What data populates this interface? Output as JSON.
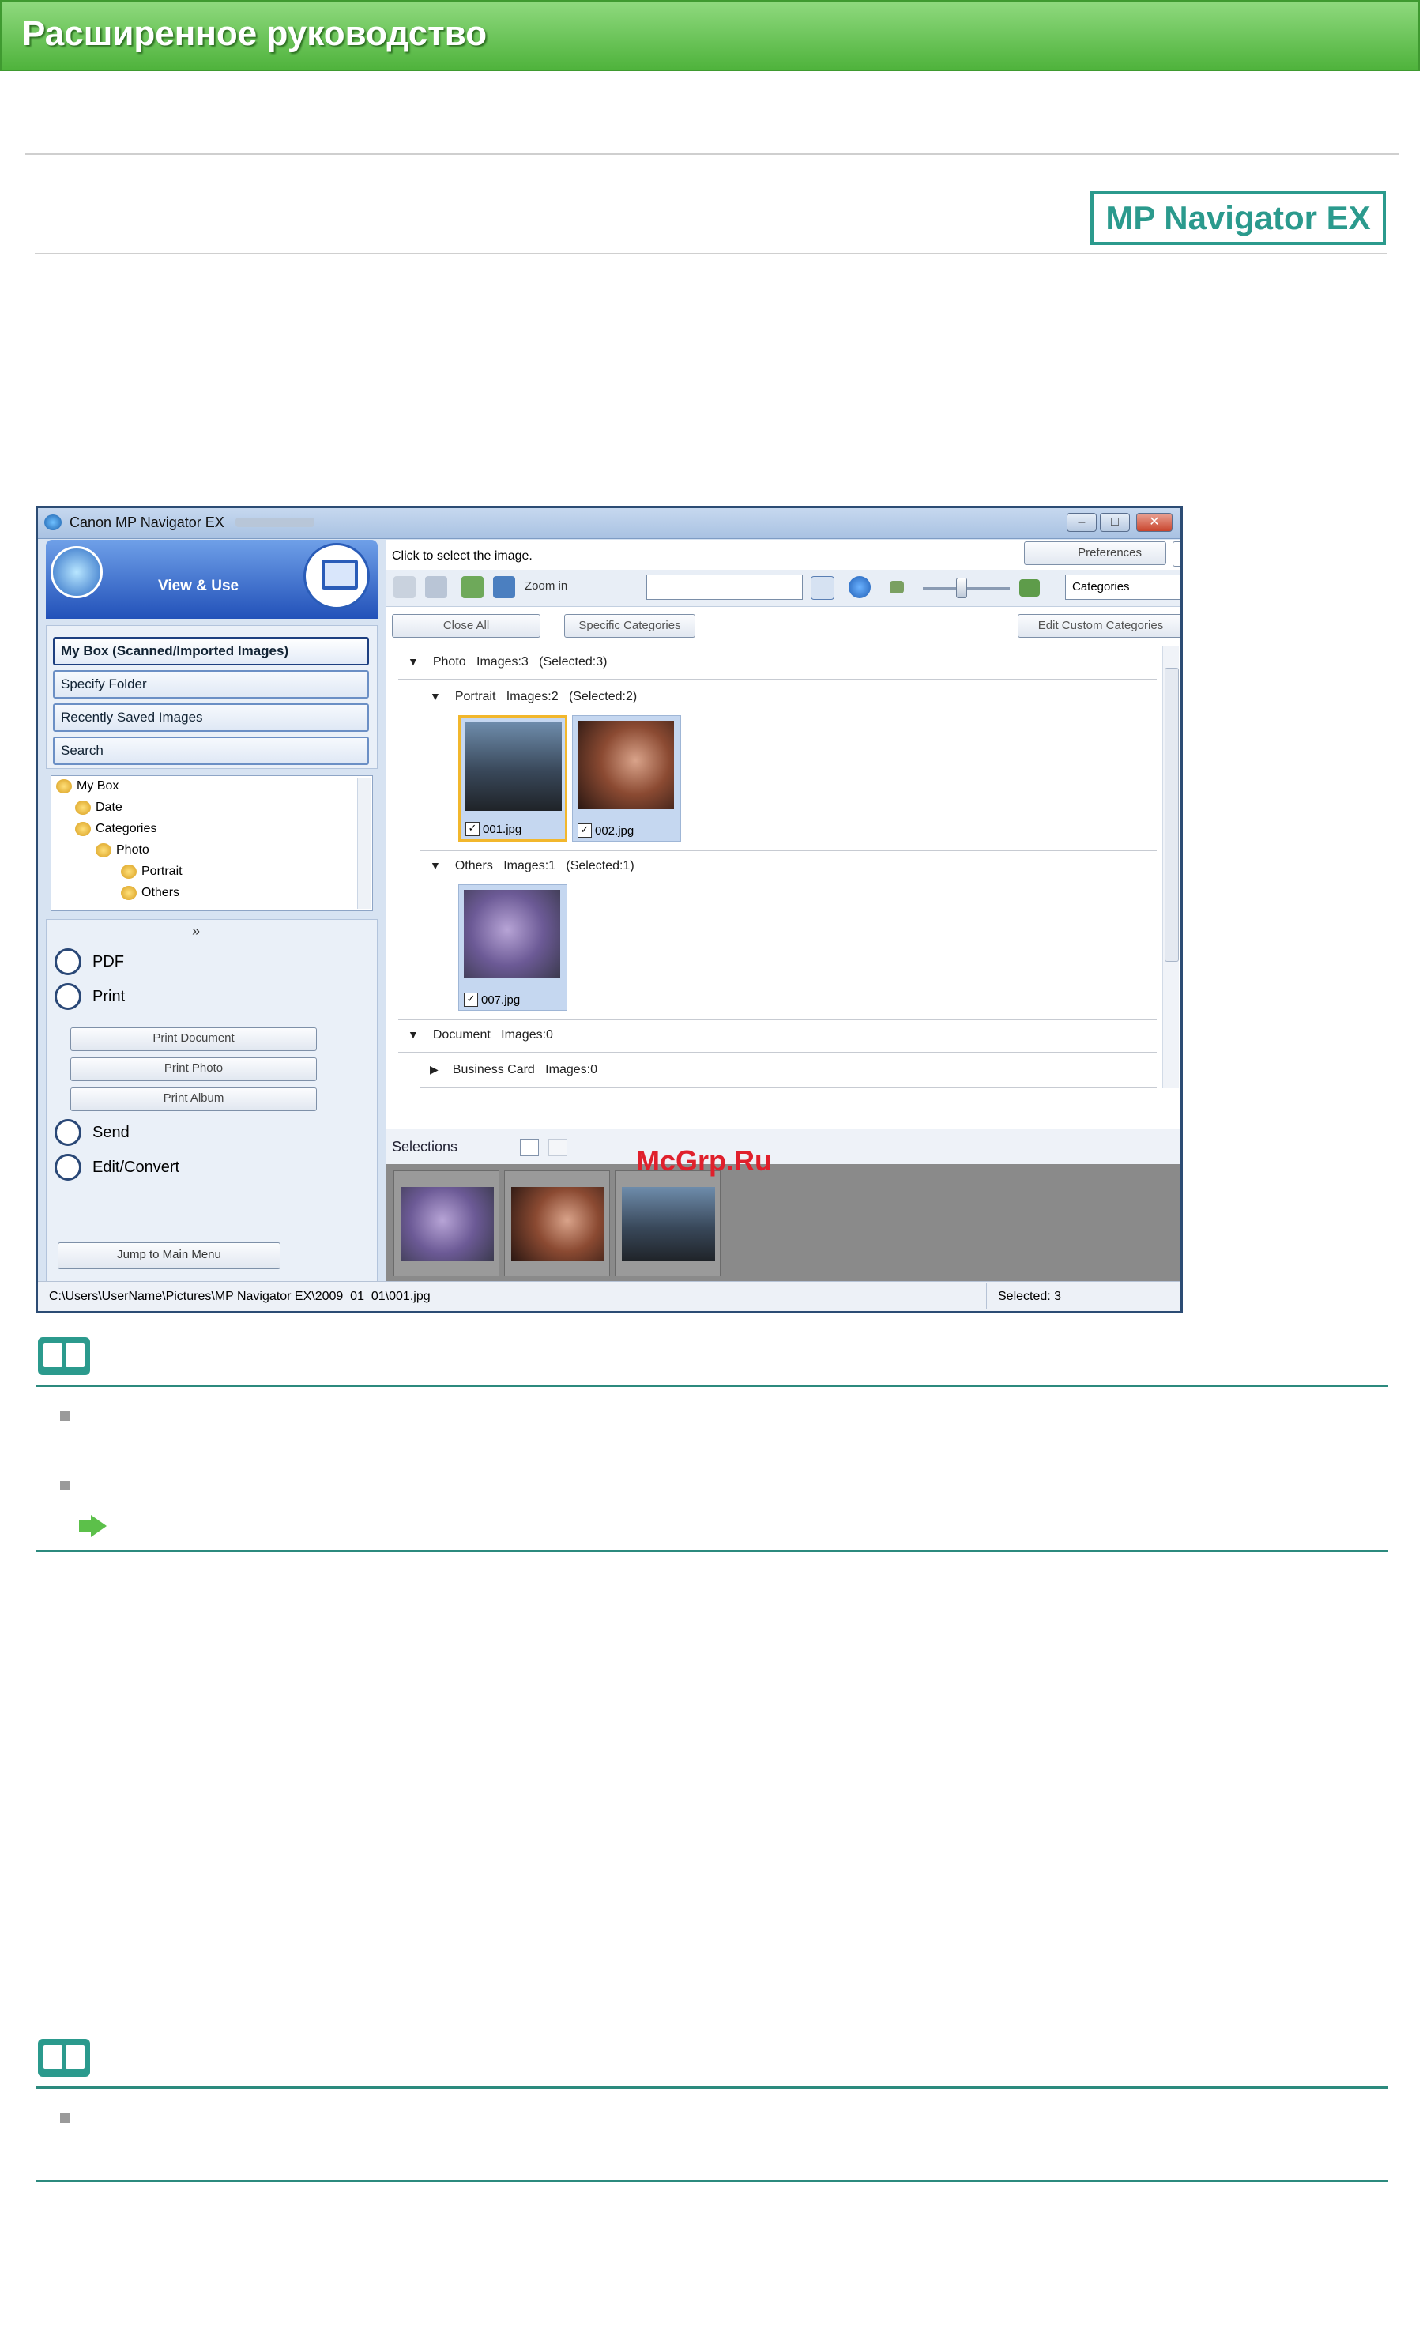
{
  "header": {
    "title": "Расширенное руководство"
  },
  "badge": {
    "label": "MP Navigator EX"
  },
  "window": {
    "title": "Canon MP Navigator EX",
    "mode_label": "View & Use",
    "nav_buttons": [
      "My Box (Scanned/Imported Images)",
      "Specify Folder",
      "Recently Saved Images",
      "Search"
    ],
    "tree": [
      "My Box",
      "Date",
      "Categories",
      "Photo",
      "Portrait",
      "Others"
    ],
    "actions": {
      "pdf": "PDF",
      "print": "Print",
      "send": "Send",
      "edit": "Edit/Convert"
    },
    "print_sub": [
      "Print Document",
      "Print Photo",
      "Print Album"
    ],
    "jump": "Jump to Main Menu",
    "instruction": "Click to select the image.",
    "preferences": "Preferences",
    "help": "?",
    "zoom_in": "Zoom in",
    "category_select": "Categories",
    "close_all": "Close All",
    "specific_categories": "Specific Categories",
    "edit_custom": "Edit Custom Categories",
    "groups": {
      "photo": {
        "name": "Photo",
        "images": "Images:3",
        "selected": "(Selected:3)"
      },
      "portrait": {
        "name": "Portrait",
        "images": "Images:2",
        "selected": "(Selected:2)"
      },
      "others": {
        "name": "Others",
        "images": "Images:1",
        "selected": "(Selected:1)"
      },
      "document": {
        "name": "Document",
        "images": "Images:0"
      },
      "business": {
        "name": "Business Card",
        "images": "Images:0"
      }
    },
    "thumbs": [
      "001.jpg",
      "002.jpg",
      "007.jpg"
    ],
    "selections_label": "Selections",
    "status_path": "C:\\Users\\UserName\\Pictures\\MP Navigator EX\\2009_01_01\\001.jpg",
    "status_selected": "Selected: 3"
  },
  "watermark": "McGrp.Ru",
  "colors": {
    "accent": "#2b9a8d",
    "header_green": "#4fb33c"
  }
}
